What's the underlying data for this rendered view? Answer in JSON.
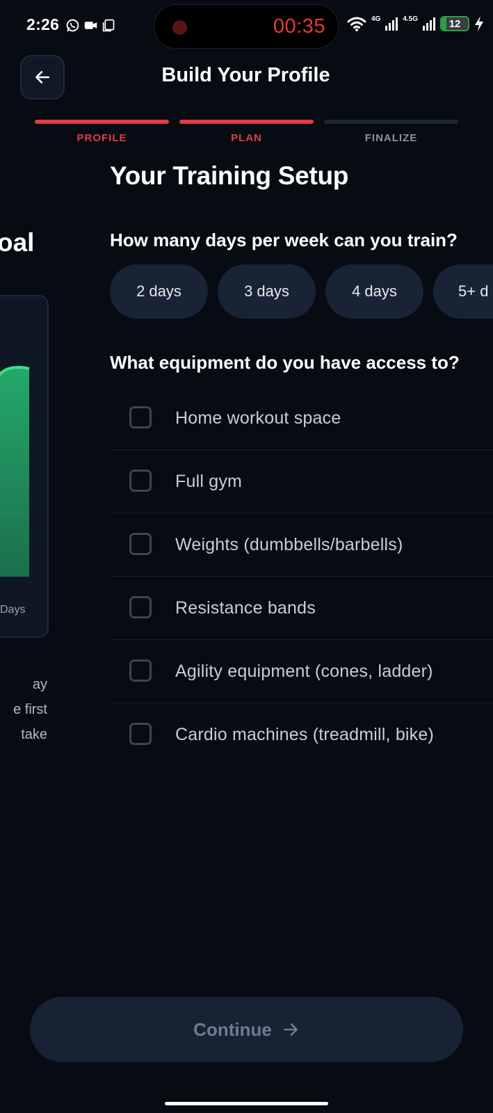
{
  "status_bar": {
    "time": "2:26",
    "recording_timer": "00:35",
    "net_primary": "4G",
    "net_secondary": "4.5G",
    "battery": "12",
    "icons": [
      "whatsapp-icon",
      "video-call-icon",
      "copy-icon",
      "wifi-icon",
      "signal-icon",
      "charging-icon"
    ]
  },
  "header": {
    "title": "Build Your Profile",
    "back_icon": "arrow-left-icon"
  },
  "stepper": {
    "steps": [
      {
        "label": "PROFILE",
        "state": "complete"
      },
      {
        "label": "PLAN",
        "state": "active"
      },
      {
        "label": "FINALIZE",
        "state": "pending"
      }
    ]
  },
  "previous_slide": {
    "title_fragment": "oal",
    "axis_label_fragment": "Days",
    "text_lines": [
      "ay",
      "e first",
      "take"
    ]
  },
  "training_setup": {
    "title": "Your Training Setup",
    "days_question": "How many days per week can you train?",
    "day_options": [
      "2 days",
      "3 days",
      "4 days",
      "5+ d"
    ],
    "equipment_question": "What equipment do you have access to?",
    "equipment_options": [
      {
        "label": "Home workout space",
        "checked": false
      },
      {
        "label": "Full gym",
        "checked": false
      },
      {
        "label": "Weights (dumbbells/barbells)",
        "checked": false
      },
      {
        "label": "Resistance bands",
        "checked": false
      },
      {
        "label": "Agility equipment (cones, ladder)",
        "checked": false
      },
      {
        "label": "Cardio machines (treadmill, bike)",
        "checked": false
      }
    ]
  },
  "footer": {
    "continue_label": "Continue"
  },
  "colors": {
    "background": "#070b12",
    "accent": "#e33a45",
    "surface": "#182335",
    "muted_text": "#6f7b8e",
    "chart_green": "#2ecc71"
  }
}
